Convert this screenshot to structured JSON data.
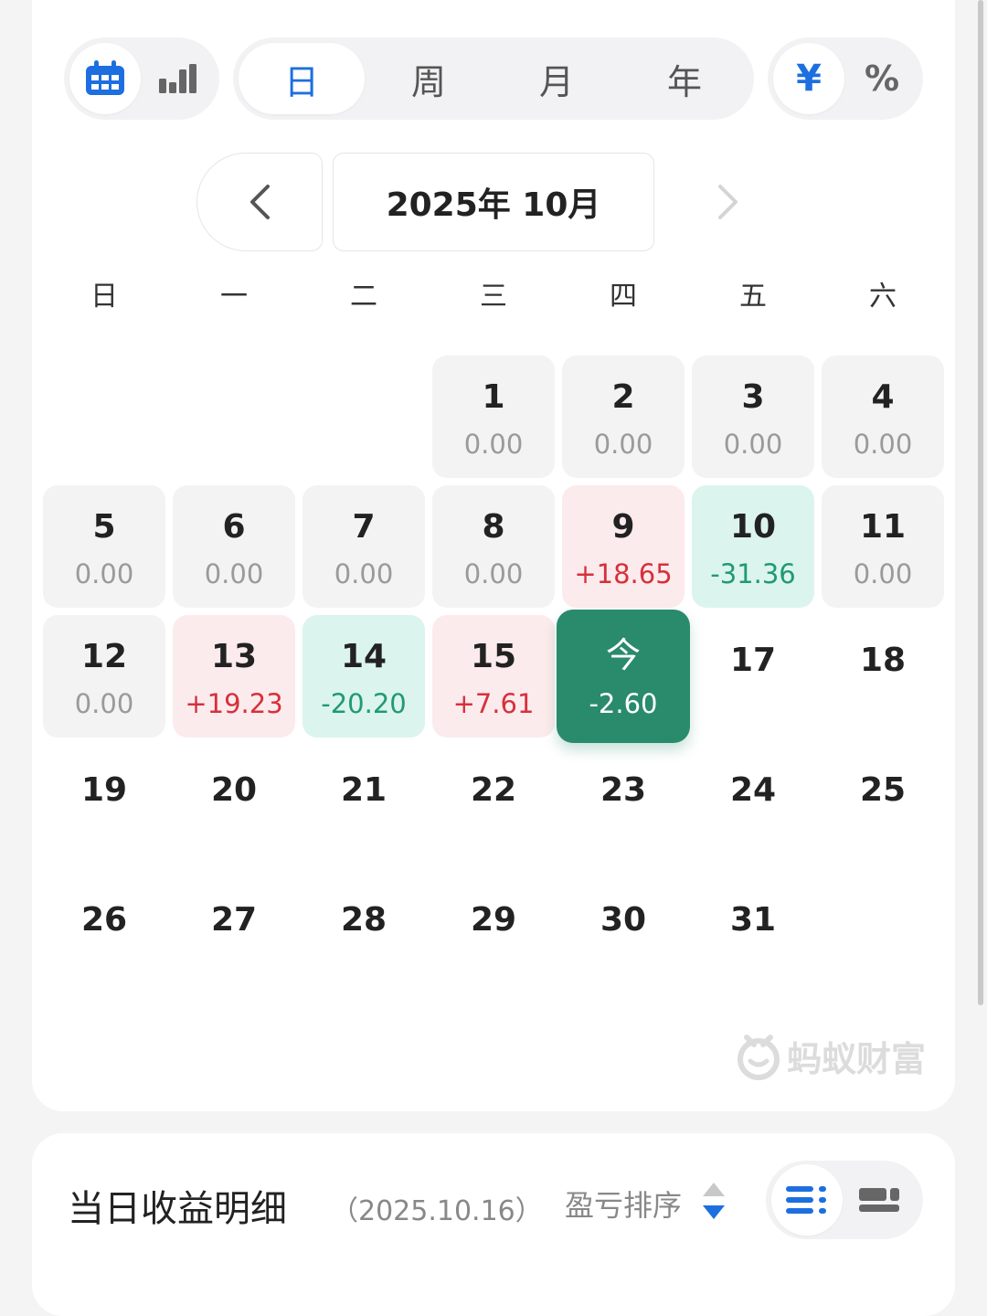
{
  "toolbar": {
    "icons": [
      "calendar-icon",
      "bar-chart-icon"
    ],
    "periods": [
      "日",
      "周",
      "月",
      "年"
    ],
    "active_period": "日",
    "units": [
      "¥",
      "%"
    ],
    "active_unit": "¥",
    "accent": "#1d6fe0"
  },
  "nav": {
    "title": "2025年 10月",
    "prev_icon": "chevron-left-icon",
    "next_icon": "chevron-right-icon"
  },
  "weekdays": [
    "日",
    "一",
    "二",
    "三",
    "四",
    "五",
    "六"
  ],
  "calendar": {
    "days": [
      {
        "num": "1",
        "val": "0.00",
        "type": "g"
      },
      {
        "num": "2",
        "val": "0.00",
        "type": "g"
      },
      {
        "num": "3",
        "val": "0.00",
        "type": "g"
      },
      {
        "num": "4",
        "val": "0.00",
        "type": "g"
      },
      {
        "num": "5",
        "val": "0.00",
        "type": "g"
      },
      {
        "num": "6",
        "val": "0.00",
        "type": "g"
      },
      {
        "num": "7",
        "val": "0.00",
        "type": "g"
      },
      {
        "num": "8",
        "val": "0.00",
        "type": "g"
      },
      {
        "num": "9",
        "val": "+18.65",
        "type": "r"
      },
      {
        "num": "10",
        "val": "-31.36",
        "type": "t"
      },
      {
        "num": "11",
        "val": "0.00",
        "type": "g"
      },
      {
        "num": "12",
        "val": "0.00",
        "type": "g"
      },
      {
        "num": "13",
        "val": "+19.23",
        "type": "r"
      },
      {
        "num": "14",
        "val": "-20.20",
        "type": "t"
      },
      {
        "num": "15",
        "val": "+7.61",
        "type": "r"
      },
      {
        "num": "今",
        "val": "-2.60",
        "type": "today"
      },
      {
        "num": "17",
        "val": "",
        "type": "plain"
      },
      {
        "num": "18",
        "val": "",
        "type": "plain"
      },
      {
        "num": "19",
        "val": "",
        "type": "plain"
      },
      {
        "num": "20",
        "val": "",
        "type": "plain"
      },
      {
        "num": "21",
        "val": "",
        "type": "plain"
      },
      {
        "num": "22",
        "val": "",
        "type": "plain"
      },
      {
        "num": "23",
        "val": "",
        "type": "plain"
      },
      {
        "num": "24",
        "val": "",
        "type": "plain"
      },
      {
        "num": "25",
        "val": "",
        "type": "plain"
      },
      {
        "num": "26",
        "val": "",
        "type": "plain"
      },
      {
        "num": "27",
        "val": "",
        "type": "plain"
      },
      {
        "num": "28",
        "val": "",
        "type": "plain"
      },
      {
        "num": "29",
        "val": "",
        "type": "plain"
      },
      {
        "num": "30",
        "val": "",
        "type": "plain"
      },
      {
        "num": "31",
        "val": "",
        "type": "plain"
      }
    ],
    "colors": {
      "gain": "#d6303c",
      "loss": "#1f9a73",
      "today": "#2a8a6c"
    }
  },
  "watermark": {
    "text": "蚂蚁财富",
    "icon": "ant-logo-icon"
  },
  "detail": {
    "title": "当日收益明细",
    "date": "（2025.10.16）",
    "sort_label": "盈亏排序",
    "sort_icon": "sort-arrows-icon",
    "view_icons": [
      "list-view-icon",
      "card-view-icon"
    ]
  }
}
